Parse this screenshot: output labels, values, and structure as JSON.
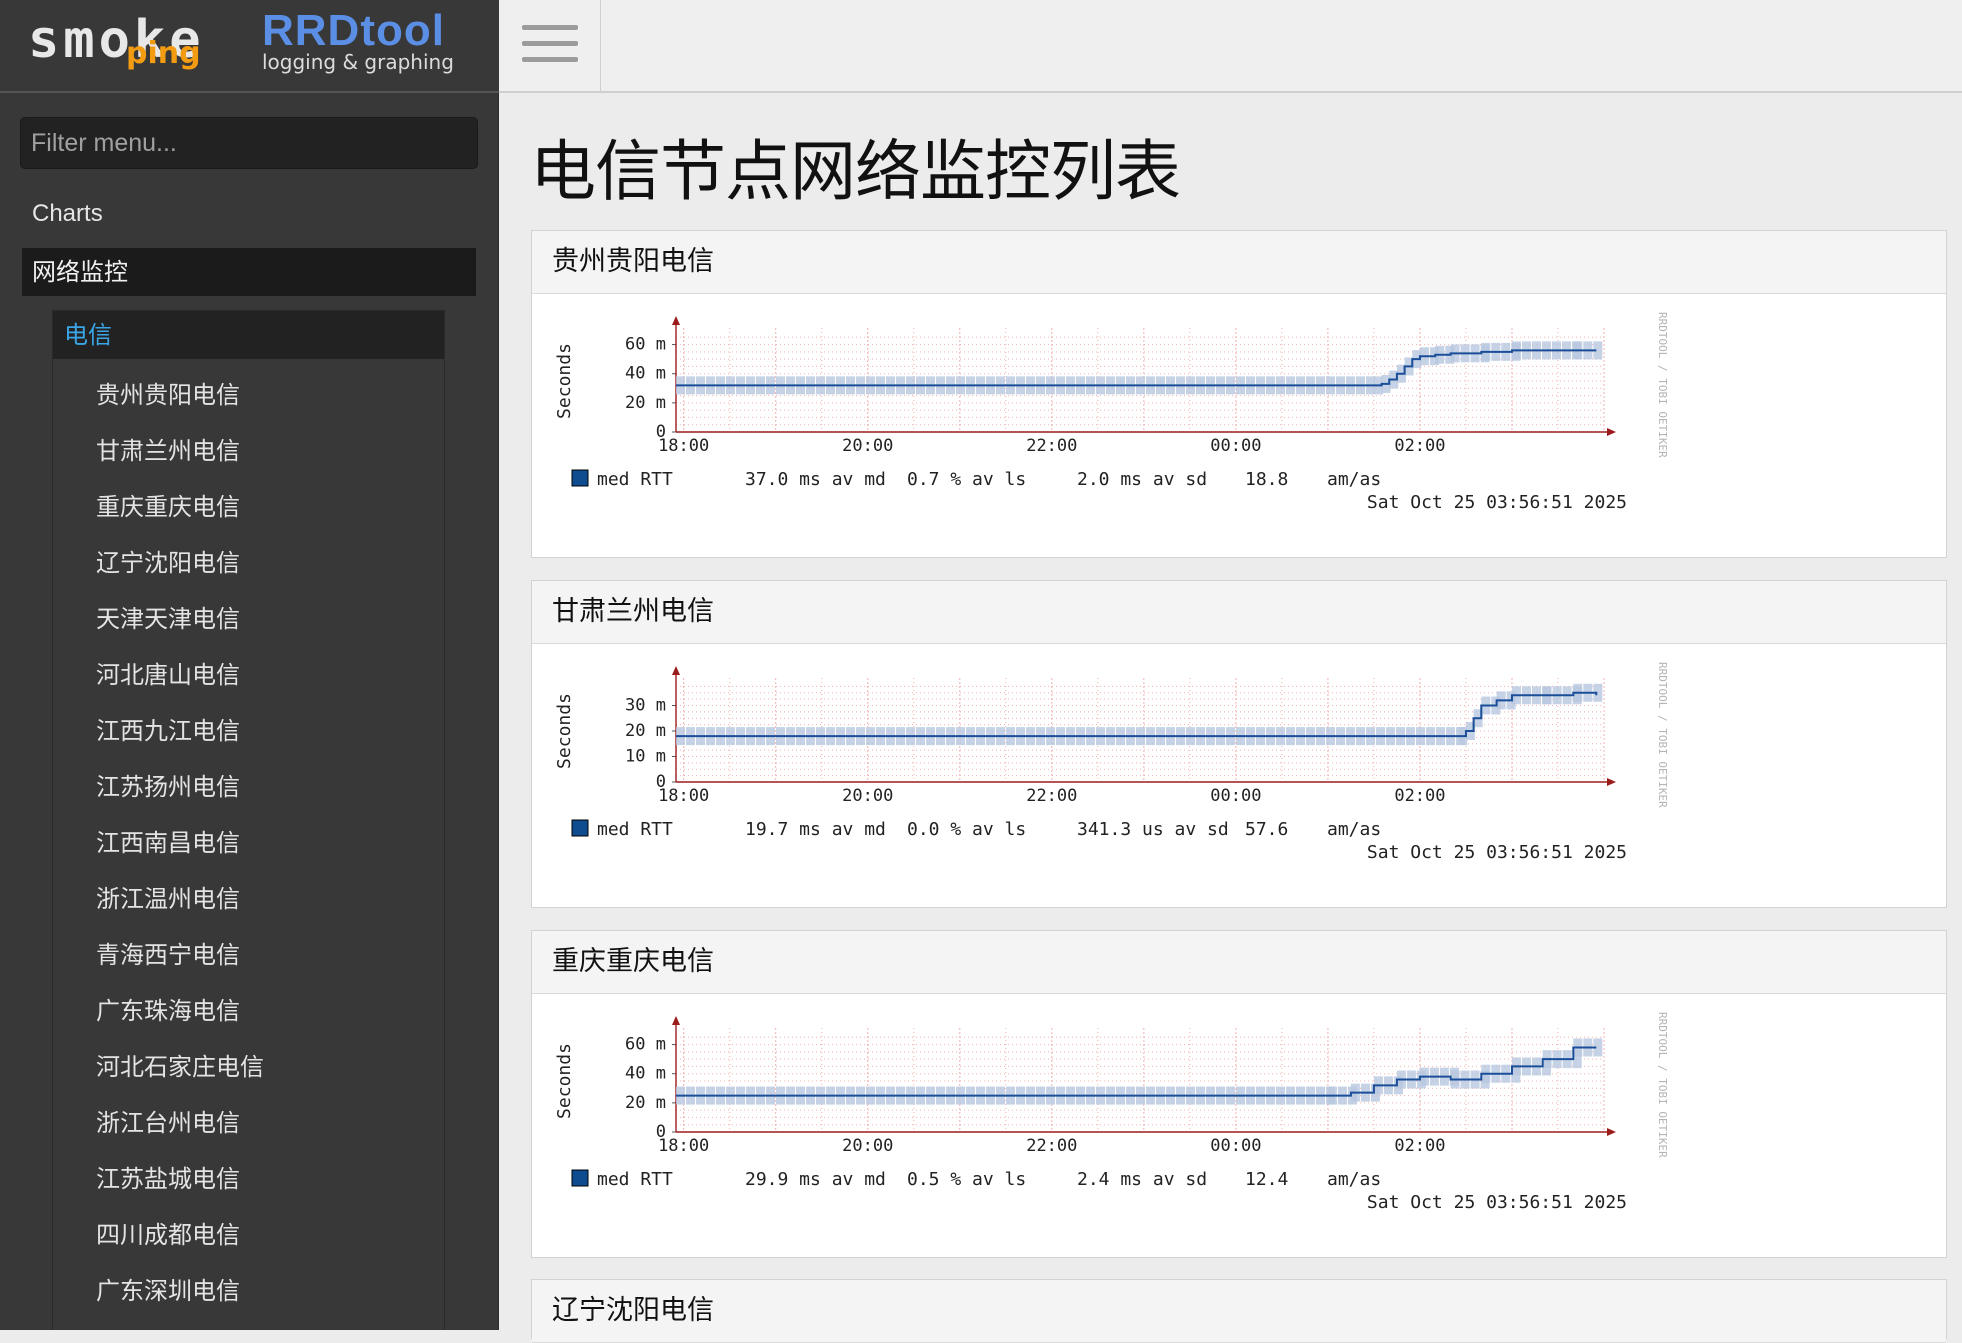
{
  "logo": {
    "smoke": "smoke",
    "ping": "ping",
    "rrd": "RRDtool",
    "rrd_sub": "logging & graphing"
  },
  "sidebar": {
    "filter_placeholder": "Filter menu...",
    "charts_label": "Charts",
    "section_label": "网络监控",
    "group_label": "电信",
    "items": [
      "贵州贵阳电信",
      "甘肃兰州电信",
      "重庆重庆电信",
      "辽宁沈阳电信",
      "天津天津电信",
      "河北唐山电信",
      "江西九江电信",
      "江苏扬州电信",
      "江西南昌电信",
      "浙江温州电信",
      "青海西宁电信",
      "广东珠海电信",
      "河北石家庄电信",
      "浙江台州电信",
      "江苏盐城电信",
      "四川成都电信",
      "广东深圳电信"
    ]
  },
  "main": {
    "title": "电信节点网络监控列表"
  },
  "colors": {
    "line": "#1a4e99",
    "smoke": "#b8c8e0",
    "grid": "#f2b0b0",
    "axis": "#9c1c1c",
    "accent_blue": "#3aa6e8"
  },
  "chart_data": [
    {
      "type": "line",
      "panel_title": "贵州贵阳电信",
      "ylabel": "Seconds",
      "ytick_labels": [
        "60 m",
        "40 m",
        "20 m",
        "0"
      ],
      "ytick_values": [
        60,
        40,
        20,
        0
      ],
      "ylim": [
        0,
        70
      ],
      "xtick_labels": [
        "18:00",
        "20:00",
        "22:00",
        "00:00",
        "02:00"
      ],
      "xlim": [
        "17:55",
        "04:00"
      ],
      "series": [
        {
          "name": "med RTT",
          "x": [
            "17:55",
            "01:30",
            "01:35",
            "01:40",
            "01:45",
            "01:50",
            "01:55",
            "02:00",
            "02:10",
            "02:20",
            "02:40",
            "03:00",
            "03:40",
            "03:55"
          ],
          "values": [
            32,
            32,
            33,
            36,
            40,
            45,
            50,
            52,
            53,
            54,
            55,
            56,
            56,
            56
          ]
        }
      ],
      "legend": [
        "med RTT",
        "37.0 ms av md",
        "0.7 % av ls",
        "2.0 ms av sd",
        "18.8",
        "am/as"
      ],
      "timestamp": "Sat Oct 25 03:56:51 2025",
      "watermark": "RRDTOOL / TOBI OETIKER"
    },
    {
      "type": "line",
      "panel_title": "甘肃兰州电信",
      "ylabel": "Seconds",
      "ytick_labels": [
        "30 m",
        "20 m",
        "10 m",
        "0"
      ],
      "ytick_values": [
        30,
        20,
        10,
        0
      ],
      "ylim": [
        0,
        40
      ],
      "xtick_labels": [
        "18:00",
        "20:00",
        "22:00",
        "00:00",
        "02:00"
      ],
      "xlim": [
        "17:55",
        "04:00"
      ],
      "series": [
        {
          "name": "med RTT",
          "x": [
            "17:55",
            "02:25",
            "02:30",
            "02:35",
            "02:40",
            "02:50",
            "03:00",
            "03:20",
            "03:40",
            "03:55"
          ],
          "values": [
            18,
            18,
            20,
            25,
            30,
            32,
            34,
            34,
            35,
            34
          ]
        }
      ],
      "legend": [
        "med RTT",
        "19.7 ms av md",
        "0.0 % av ls",
        "341.3 us av sd",
        "57.6",
        "am/as"
      ],
      "timestamp": "Sat Oct 25 03:56:51 2025",
      "watermark": "RRDTOOL / TOBI OETIKER"
    },
    {
      "type": "line",
      "panel_title": "重庆重庆电信",
      "ylabel": "Seconds",
      "ytick_labels": [
        "60 m",
        "40 m",
        "20 m",
        "0"
      ],
      "ytick_values": [
        60,
        40,
        20,
        0
      ],
      "ylim": [
        0,
        70
      ],
      "xtick_labels": [
        "18:00",
        "20:00",
        "22:00",
        "00:00",
        "02:00"
      ],
      "xlim": [
        "17:55",
        "04:00"
      ],
      "series": [
        {
          "name": "med RTT",
          "x": [
            "17:55",
            "01:00",
            "01:15",
            "01:30",
            "01:45",
            "02:00",
            "02:20",
            "02:40",
            "03:00",
            "03:20",
            "03:40",
            "03:55"
          ],
          "values": [
            25,
            25,
            27,
            32,
            36,
            38,
            36,
            40,
            45,
            50,
            58,
            58
          ]
        }
      ],
      "legend": [
        "med RTT",
        "29.9 ms av md",
        "0.5 % av ls",
        "2.4 ms av sd",
        "12.4",
        "am/as"
      ],
      "timestamp": "Sat Oct 25 03:56:51 2025",
      "watermark": "RRDTOOL / TOBI OETIKER"
    },
    {
      "type": "line",
      "panel_title": "辽宁沈阳电信"
    }
  ]
}
